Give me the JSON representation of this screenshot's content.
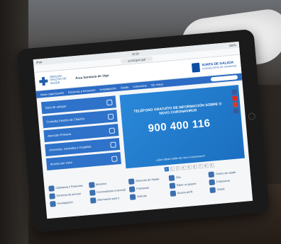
{
  "statusbar": {
    "time": "10:26",
    "battery": "100%"
  },
  "browser": {
    "url": "a.sergas.gal"
  },
  "header": {
    "sergas_name": "SERVIZO GALEGO DE SAÚDE",
    "area_name": "Área Sanitaria de Vigo",
    "xunta_name": "XUNTA DE GALICIA",
    "xunta_dept": "CONSELLERÍA DE SANIDADE"
  },
  "menu": {
    "items": [
      "Nosa organización",
      "Docencia e formación",
      "Investigación",
      "Saúde",
      "Coleccións",
      "Ver mapa"
    ]
  },
  "quicklinks": [
    {
      "label": "Guía de sangue"
    },
    {
      "label": "Consulta Xestión de Citación"
    },
    {
      "label": "Atención Primaria"
    },
    {
      "label": "Urxencias, consultas e hospitais"
    },
    {
      "label": "Acceso por zona"
    }
  ],
  "banner": {
    "title": "TELÉFONO GRATUÍTO DE INFORMACIÓN SOBRE O NOVO CORONAVIRUS",
    "phone": "900 400 116",
    "footer": "¿Que debes saber do novo Coronavirus?"
  },
  "pager": [
    "1",
    "2",
    "3",
    "4",
    "5",
    "6",
    "7",
    "8",
    "9"
  ],
  "links": [
    {
      "label": "Cidadanía e Pacientes"
    },
    {
      "label": "Ministros"
    },
    {
      "label": "Dirección de Saúde"
    },
    {
      "label": "Cita"
    },
    {
      "label": "Centro de saúde"
    },
    {
      "label": "Gerencia do persoal"
    },
    {
      "label": "Convocatorias e persoal"
    },
    {
      "label": "Farmacias"
    },
    {
      "label": "Saber os grupos"
    },
    {
      "label": "Enfermaría"
    },
    {
      "label": "Investigación"
    },
    {
      "label": "Información para ti"
    },
    {
      "label": "Noticias"
    },
    {
      "label": "Acceso perfil"
    },
    {
      "label": "Dixital"
    }
  ],
  "colors": {
    "primary": "#2e72c9",
    "banner": "#2a88d8",
    "xunta": "#0c4da2"
  }
}
